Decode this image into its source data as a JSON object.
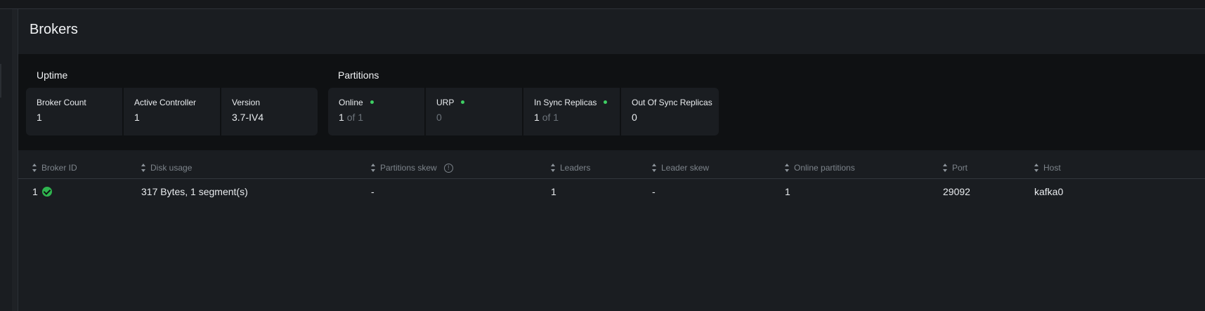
{
  "page": {
    "title": "Brokers"
  },
  "uptime": {
    "label": "Uptime",
    "cards": [
      {
        "label": "Broker Count",
        "value": "1"
      },
      {
        "label": "Active Controller",
        "value": "1"
      },
      {
        "label": "Version",
        "value": "3.7-IV4"
      }
    ]
  },
  "partitions": {
    "label": "Partitions",
    "cards": [
      {
        "label": "Online",
        "value": "1",
        "suffix": "of 1",
        "status": "ok"
      },
      {
        "label": "URP",
        "value": "0",
        "status": "ok"
      },
      {
        "label": "In Sync Replicas",
        "value": "1",
        "suffix": "of 1",
        "status": "ok"
      },
      {
        "label": "Out Of Sync Replicas",
        "value": "0"
      }
    ]
  },
  "table": {
    "columns": [
      "Broker ID",
      "Disk usage",
      "Partitions skew",
      "Leaders",
      "Leader skew",
      "Online partitions",
      "Port",
      "Host"
    ],
    "rows": [
      {
        "broker_id": "1",
        "disk_usage": "317 Bytes, 1 segment(s)",
        "partitions_skew": "-",
        "leaders": "1",
        "leader_skew": "-",
        "online_partitions": "1",
        "port": "29092",
        "host": "kafka0"
      }
    ]
  },
  "colors": {
    "background": "#1a1d21",
    "band": "#0f1113",
    "status_ok": "#3ecf63"
  }
}
